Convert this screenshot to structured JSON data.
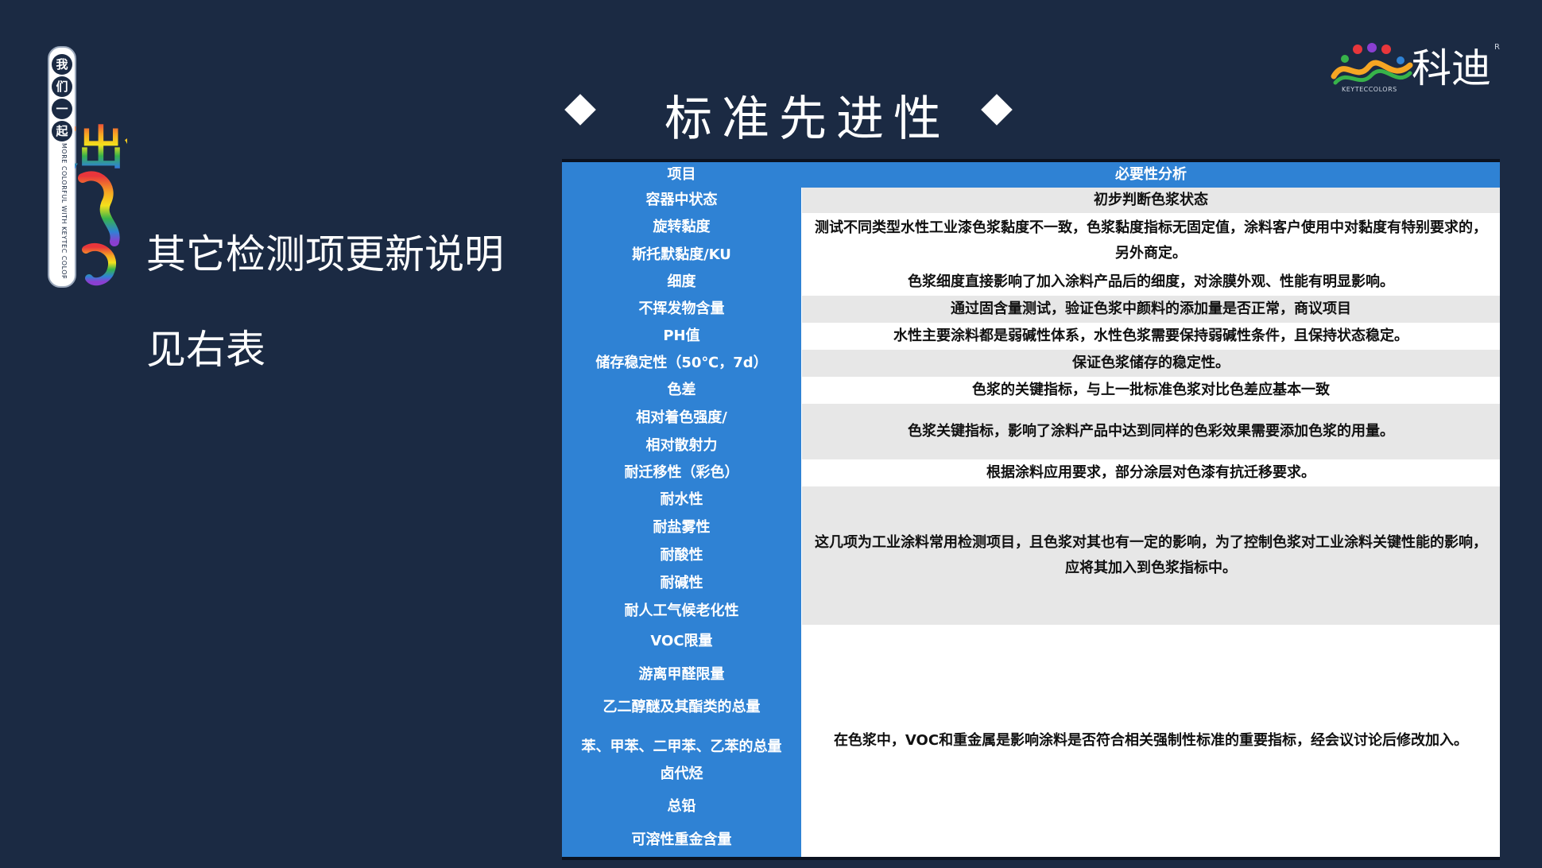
{
  "side_banner": {
    "chars": [
      "我",
      "们",
      "一",
      "起"
    ],
    "en_text": "MORE COLORFUL WITH KEYTEC COLORS",
    "art_text": "更出色"
  },
  "left": {
    "title": "其它检测项更新说明",
    "subtitle": "见右表"
  },
  "logo": {
    "name": "科迪",
    "reg": "R",
    "en": "KEYTECCOLORS"
  },
  "heading": "标准先进性",
  "table": {
    "headers": [
      "项目",
      "必要性分析"
    ],
    "groups": [
      {
        "items": [
          "容器中状态"
        ],
        "analysis": "初步判断色浆状态",
        "shade": "grey"
      },
      {
        "items": [
          "旋转黏度",
          "斯托默黏度/KU"
        ],
        "analysis": "测试不同类型水性工业漆色浆黏度不一致，色浆黏度指标无固定值，涂料客户使用中对黏度有特别要求的，另外商定。",
        "shade": "white"
      },
      {
        "items": [
          "细度"
        ],
        "analysis": "色浆细度直接影响了加入涂料产品后的细度，对涂膜外观、性能有明显影响。",
        "shade": "white"
      },
      {
        "items": [
          "不挥发物含量"
        ],
        "analysis": "通过固含量测试，验证色浆中颜料的添加量是否正常，商议项目",
        "shade": "grey"
      },
      {
        "items": [
          "PH值"
        ],
        "analysis": "水性主要涂料都是弱碱性体系，水性色浆需要保持弱碱性条件，且保持状态稳定。",
        "shade": "white"
      },
      {
        "items": [
          "储存稳定性（50℃，7d）"
        ],
        "analysis": "保证色浆储存的稳定性。",
        "shade": "grey"
      },
      {
        "items": [
          "色差"
        ],
        "analysis": "色浆的关键指标，与上一批标准色浆对比色差应基本一致",
        "shade": "white"
      },
      {
        "items": [
          "相对着色强度/",
          "相对散射力"
        ],
        "analysis": "色浆关键指标，影响了涂料产品中达到同样的色彩效果需要添加色浆的用量。",
        "shade": "grey"
      },
      {
        "items": [
          "耐迁移性（彩色）"
        ],
        "analysis": "根据涂料应用要求，部分涂层对色漆有抗迁移要求。",
        "shade": "white"
      },
      {
        "items": [
          "耐水性",
          "耐盐雾性",
          "耐酸性",
          "耐碱性",
          "耐人工气候老化性"
        ],
        "analysis": "这几项为工业涂料常用检测项目，且色浆对其也有一定的影响，为了控制色浆对工业涂料关键性能的影响，应将其加入到色浆指标中。",
        "shade": "grey"
      },
      {
        "items": [
          "VOC限量",
          "游离甲醛限量",
          "乙二醇醚及其酯类的总量",
          "苯、甲苯、二甲苯、乙苯的总量",
          "卤代烃",
          "总铅",
          "可溶性重金含量"
        ],
        "analysis": "在色浆中，VOC和重金属是影响涂料是否符合相关强制性标准的重要指标，经会议讨论后修改加入。",
        "shade": "white"
      }
    ]
  }
}
